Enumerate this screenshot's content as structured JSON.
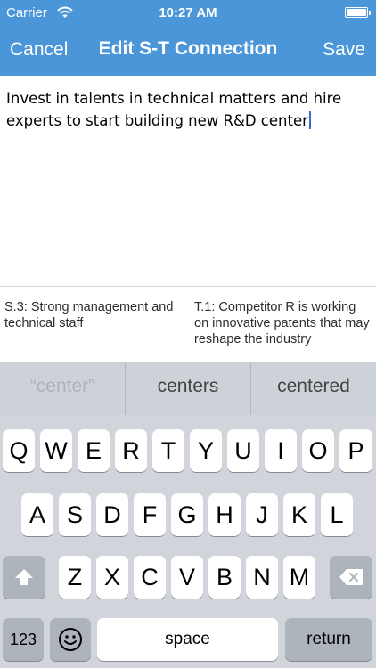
{
  "status_bar": {
    "carrier": "Carrier",
    "time": "10:27 AM",
    "wifi_icon": "wifi-icon",
    "battery_icon": "battery-icon"
  },
  "nav": {
    "cancel_label": "Cancel",
    "title": "Edit S-T Connection",
    "save_label": "Save"
  },
  "editor": {
    "text": "Invest in talents in technical matters and hire experts to start building new R&D center"
  },
  "pair": {
    "strength": "S.3: Strong management and technical staff",
    "threat": "T.1: Competitor R is working on innovative patents that may reshape the industry"
  },
  "keyboard": {
    "suggestions": [
      "“center”",
      "centers",
      "centered"
    ],
    "row1": [
      "Q",
      "W",
      "E",
      "R",
      "T",
      "Y",
      "U",
      "I",
      "O",
      "P"
    ],
    "row2": [
      "A",
      "S",
      "D",
      "F",
      "G",
      "H",
      "J",
      "K",
      "L"
    ],
    "row3": [
      "Z",
      "X",
      "C",
      "V",
      "B",
      "N",
      "M"
    ],
    "numbers_label": "123",
    "space_label": "space",
    "return_label": "return",
    "shift_icon": "shift-icon",
    "delete_icon": "delete-icon",
    "emoji_icon": "emoji-icon"
  },
  "colors": {
    "nav_bar": "#4a96d8",
    "keyboard_bg": "#d1d5db",
    "caret": "#2b6fd6"
  }
}
